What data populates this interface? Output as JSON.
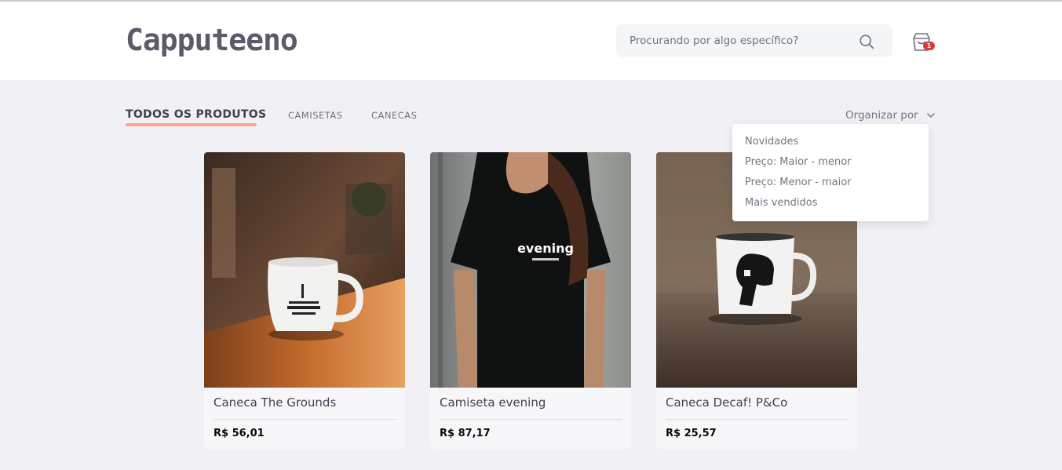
{
  "header": {
    "logo": "Capputeeno",
    "search_placeholder": "Procurando por algo específico?",
    "cart_count": "1"
  },
  "tabs": [
    {
      "label": "TODOS OS PRODUTOS",
      "active": true
    },
    {
      "label": "CAMISETAS",
      "active": false
    },
    {
      "label": "CANECAS",
      "active": false
    }
  ],
  "sort": {
    "label": "Organizar por",
    "options": [
      "Novidades",
      "Preço: Maior - menor",
      "Preço: Menor - maior",
      "Mais vendidos"
    ]
  },
  "products": [
    {
      "name": "Caneca The Grounds",
      "price": "R$ 56,01"
    },
    {
      "name": "Camiseta evening",
      "price": "R$ 87,17"
    },
    {
      "name": "Caneca Decaf! P&Co",
      "price": "R$ 25,57"
    }
  ],
  "colors": {
    "accent": "#ffa585",
    "badge": "#de3838",
    "background": "#f0f0f5",
    "text": "#41414d"
  }
}
